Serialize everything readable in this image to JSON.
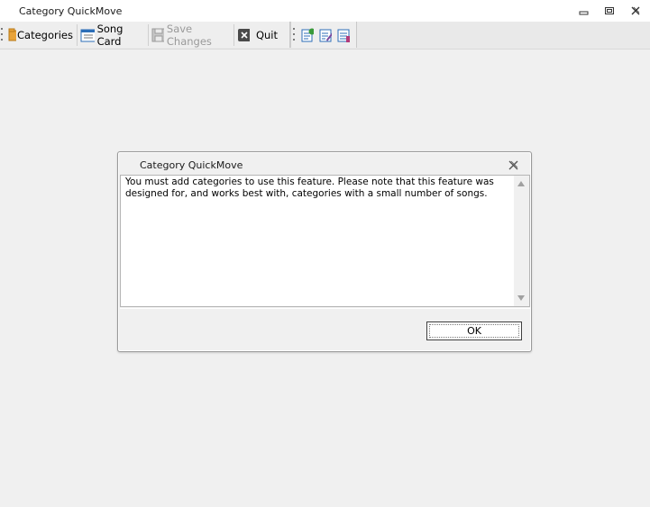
{
  "window": {
    "title": "Category QuickMove"
  },
  "toolbar": {
    "categories_label": "Categories",
    "song_card_label": "Song Card",
    "save_changes_label": "Save Changes",
    "quit_label": "Quit",
    "icons": [
      "categories-icon",
      "song-card-icon",
      "save-icon",
      "quit-icon",
      "move-song-icon",
      "edit-song-icon",
      "list-icon"
    ]
  },
  "dialog": {
    "title": "Category QuickMove",
    "message": "You must add categories to use this feature. Please note that this feature was designed for, and works best with, categories with a small number of songs.",
    "ok_label": "OK"
  },
  "colors": {
    "background": "#f0f0f0",
    "accent_green": "#3a9a3a",
    "accent_orange": "#e8a33a",
    "accent_blue": "#2d6fb8"
  }
}
